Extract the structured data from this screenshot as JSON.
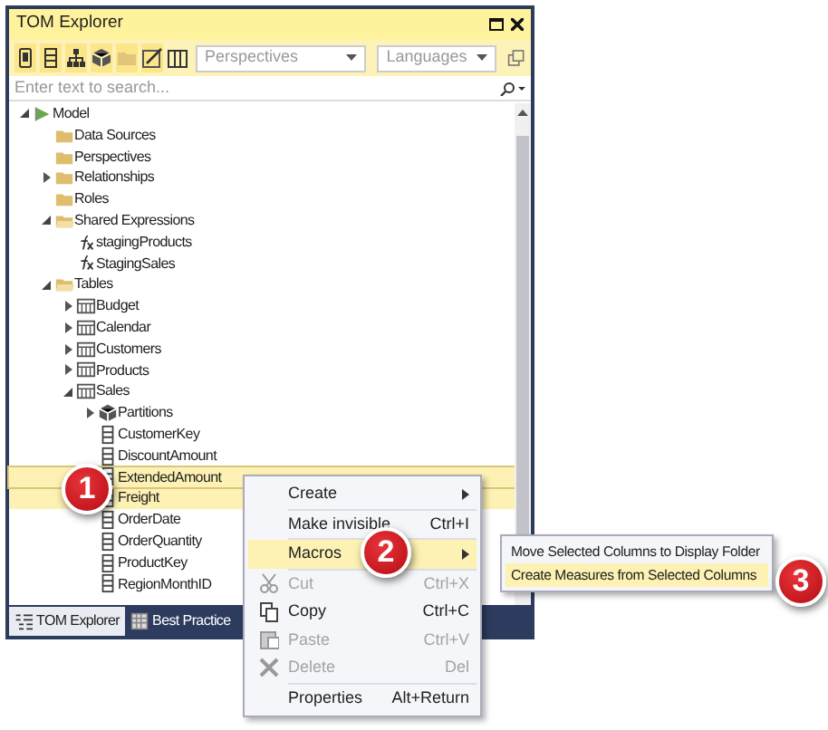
{
  "window": {
    "title": "TOM Explorer"
  },
  "toolbar": {
    "perspectives": {
      "placeholder": "Perspectives"
    },
    "languages": {
      "placeholder": "Languages"
    }
  },
  "search": {
    "placeholder": "Enter text to search..."
  },
  "tree": [
    {
      "label": "Model",
      "kind": "model",
      "expanded": true,
      "selected": false,
      "children": [
        {
          "label": "Data Sources",
          "kind": "folder",
          "selected": false
        },
        {
          "label": "Perspectives",
          "kind": "folder",
          "selected": false
        },
        {
          "label": "Relationships",
          "kind": "folder",
          "expanded": false,
          "selected": false
        },
        {
          "label": "Roles",
          "kind": "folder",
          "selected": false
        },
        {
          "label": "Shared Expressions",
          "kind": "openfolder",
          "expanded": true,
          "selected": false,
          "children": [
            {
              "label": "stagingProducts",
              "kind": "expression",
              "selected": false
            },
            {
              "label": "StagingSales",
              "kind": "expression",
              "selected": false
            }
          ]
        },
        {
          "label": "Tables",
          "kind": "openfolder",
          "expanded": true,
          "selected": false,
          "children": [
            {
              "label": "Budget",
              "kind": "table",
              "expanded": false,
              "selected": false
            },
            {
              "label": "Calendar",
              "kind": "table",
              "expanded": false,
              "selected": false
            },
            {
              "label": "Customers",
              "kind": "table",
              "expanded": false,
              "selected": false
            },
            {
              "label": "Products",
              "kind": "table",
              "expanded": false,
              "selected": false
            },
            {
              "label": "Sales",
              "kind": "table",
              "expanded": true,
              "selected": false,
              "children": [
                {
                  "label": "Partitions",
                  "kind": "partitions",
                  "expanded": false,
                  "selected": false
                },
                {
                  "label": "CustomerKey",
                  "kind": "column",
                  "selected": false
                },
                {
                  "label": "DiscountAmount",
                  "kind": "column",
                  "selected": false
                },
                {
                  "label": "ExtendedAmount",
                  "kind": "column",
                  "selected": true
                },
                {
                  "label": "Freight",
                  "kind": "column",
                  "selected": true
                },
                {
                  "label": "OrderDate",
                  "kind": "column",
                  "selected": false
                },
                {
                  "label": "OrderQuantity",
                  "kind": "column",
                  "selected": false
                },
                {
                  "label": "ProductKey",
                  "kind": "column",
                  "selected": false
                },
                {
                  "label": "RegionMonthID",
                  "kind": "column",
                  "selected": false
                }
              ]
            }
          ]
        }
      ]
    }
  ],
  "bottom_tabs": [
    {
      "label": "TOM Explorer",
      "selected": true
    },
    {
      "label": "Best Practice",
      "selected": false
    }
  ],
  "context_menu": [
    {
      "label": "Create",
      "kind": "submenu",
      "selected": false,
      "disabled": false,
      "separator_after": true
    },
    {
      "label": "Make invisible",
      "shortcut": "Ctrl+I",
      "kind": "plain",
      "selected": false,
      "disabled": false,
      "separator_after": true
    },
    {
      "label": "Macros",
      "kind": "submenu",
      "selected": true,
      "disabled": false,
      "separator_after": true
    },
    {
      "label": "Cut",
      "shortcut": "Ctrl+X",
      "kind": "cut",
      "selected": false,
      "disabled": true,
      "separator_after": false
    },
    {
      "label": "Copy",
      "shortcut": "Ctrl+C",
      "kind": "copy",
      "selected": false,
      "disabled": false,
      "separator_after": false
    },
    {
      "label": "Paste",
      "shortcut": "Ctrl+V",
      "kind": "paste",
      "selected": false,
      "disabled": true,
      "separator_after": false
    },
    {
      "label": "Delete",
      "shortcut": "Del",
      "kind": "delete",
      "selected": false,
      "disabled": true,
      "separator_after": true
    },
    {
      "label": "Properties",
      "shortcut": "Alt+Return",
      "kind": "plain",
      "selected": false,
      "disabled": false,
      "separator_after": false
    }
  ],
  "submenu": [
    {
      "label": "Move Selected Columns to Display Folder",
      "selected": false
    },
    {
      "label": "Create Measures from Selected Columns",
      "selected": true
    }
  ],
  "callouts": [
    "1",
    "2",
    "3"
  ]
}
